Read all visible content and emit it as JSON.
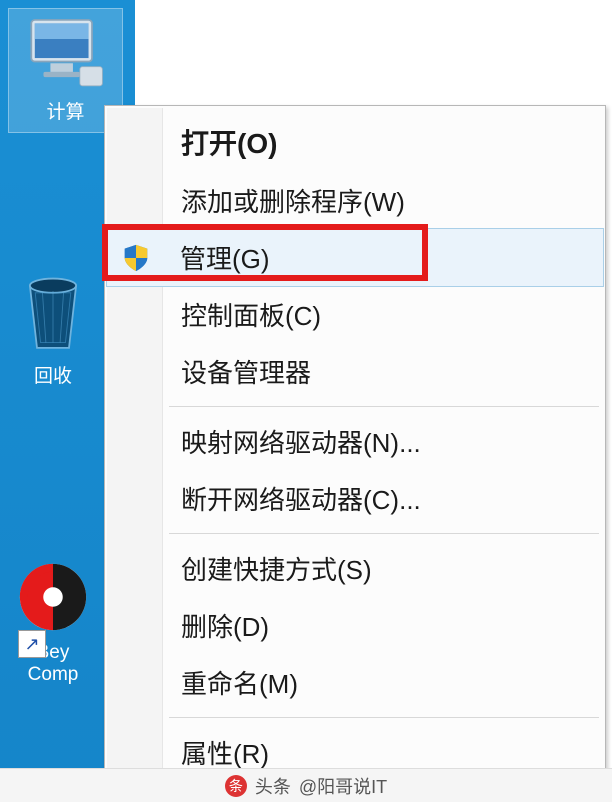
{
  "desktop": {
    "icons": {
      "computer": {
        "label": "计算"
      },
      "recycle": {
        "label": "回收"
      },
      "beyond": {
        "label": "Bey\nComp"
      }
    }
  },
  "context_menu": {
    "items": [
      {
        "label": "打开(O)",
        "bold": true
      },
      {
        "label": "添加或删除程序(W)"
      },
      {
        "label": "管理(G)",
        "shield": true,
        "hovered": true,
        "highlighted": true
      },
      {
        "label": "控制面板(C)"
      },
      {
        "label": "设备管理器"
      },
      {
        "separator": true
      },
      {
        "label": "映射网络驱动器(N)..."
      },
      {
        "label": "断开网络驱动器(C)..."
      },
      {
        "separator": true
      },
      {
        "label": "创建快捷方式(S)"
      },
      {
        "label": "删除(D)"
      },
      {
        "label": "重命名(M)"
      },
      {
        "separator": true
      },
      {
        "label": "属性(R)"
      }
    ]
  },
  "watermark": {
    "source": "头条",
    "author": "@阳哥说IT"
  }
}
